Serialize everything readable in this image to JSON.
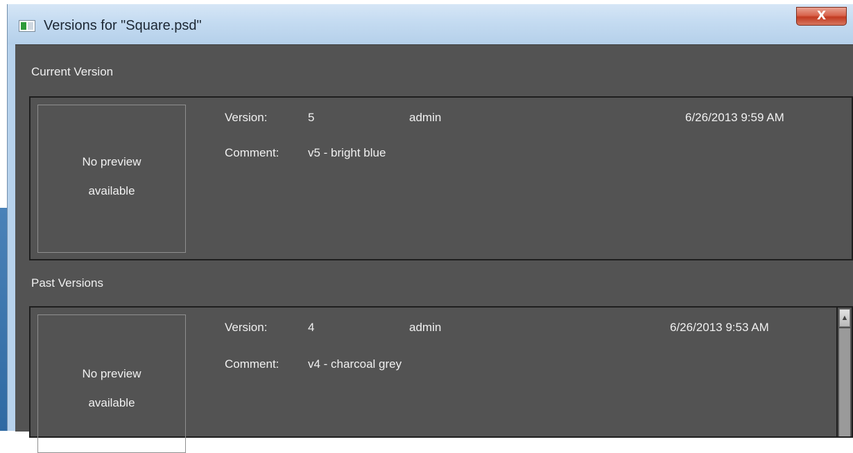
{
  "window": {
    "title": "Versions for \"Square.psd\"",
    "close_glyph": "X"
  },
  "current": {
    "heading": "Current Version",
    "preview_line1": "No preview",
    "preview_line2": "available",
    "version_label": "Version:",
    "version_value": "5",
    "user": "admin",
    "timestamp": "6/26/2013 9:59 AM",
    "comment_label": "Comment:",
    "comment_value": "v5 - bright blue"
  },
  "past": {
    "heading": "Past Versions",
    "items": [
      {
        "preview_line1": "No preview",
        "preview_line2": "available",
        "version_label": "Version:",
        "version_value": "4",
        "user": "admin",
        "timestamp": "6/26/2013 9:53 AM",
        "comment_label": "Comment:",
        "comment_value": "v4 - charcoal grey"
      }
    ]
  },
  "scrollbar": {
    "up_glyph": "▲"
  },
  "colors": {
    "panel_bg": "#535353",
    "panel_border": "#1e1e1e",
    "text": "#f0f0f0",
    "close_red": "#c23b22"
  }
}
